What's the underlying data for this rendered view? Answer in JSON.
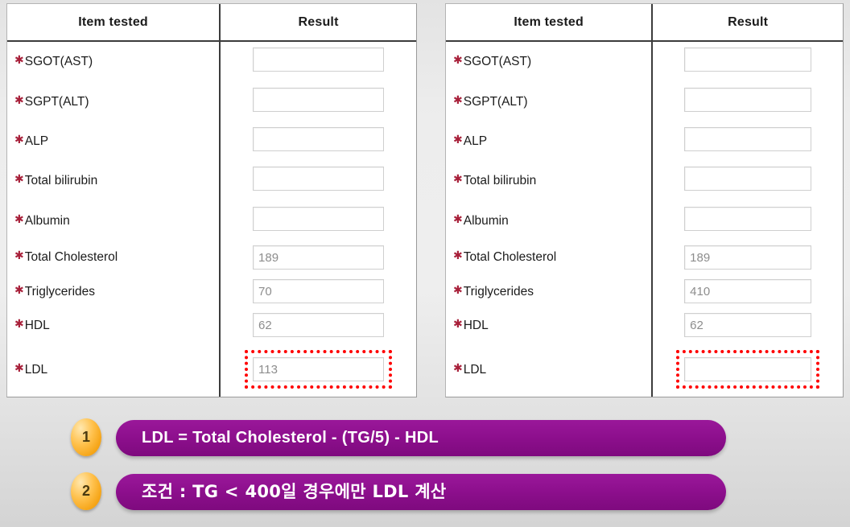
{
  "tables": {
    "columns": [
      "Item tested",
      "Result"
    ],
    "bullet": "✱",
    "left": {
      "rows": [
        {
          "label": "SGOT(AST)",
          "value": "",
          "highlight": false
        },
        {
          "label": "SGPT(ALT)",
          "value": "",
          "highlight": false
        },
        {
          "label": "ALP",
          "value": "",
          "highlight": false
        },
        {
          "label": "Total bilirubin",
          "value": "",
          "highlight": false
        },
        {
          "label": "Albumin",
          "value": "",
          "highlight": false
        },
        {
          "label": "Total Cholesterol",
          "value": "189",
          "highlight": false
        },
        {
          "label": "Triglycerides",
          "value": "70",
          "highlight": false
        },
        {
          "label": "HDL",
          "value": "62",
          "highlight": false
        },
        {
          "label": "LDL",
          "value": "113",
          "highlight": true
        }
      ]
    },
    "right": {
      "rows": [
        {
          "label": "SGOT(AST)",
          "value": "",
          "highlight": false
        },
        {
          "label": "SGPT(ALT)",
          "value": "",
          "highlight": false
        },
        {
          "label": "ALP",
          "value": "",
          "highlight": false
        },
        {
          "label": "Total bilirubin",
          "value": "",
          "highlight": false
        },
        {
          "label": "Albumin",
          "value": "",
          "highlight": false
        },
        {
          "label": "Total Cholesterol",
          "value": "189",
          "highlight": false
        },
        {
          "label": "Triglycerides",
          "value": "410",
          "highlight": false
        },
        {
          "label": "HDL",
          "value": "62",
          "highlight": false
        },
        {
          "label": "LDL",
          "value": "",
          "highlight": true
        }
      ]
    }
  },
  "callouts": [
    {
      "number": "1",
      "text": "LDL = Total Cholesterol - (TG/5) - HDL",
      "korean": false
    },
    {
      "number": "2",
      "text": "조건 : TG < 400일 경우에만 LDL 계산",
      "korean": true
    }
  ],
  "colors": {
    "pill": "#8d0f8d",
    "badge": "#f5a416",
    "highlight": "#ff0000",
    "star": "#a8203a",
    "value_text": "#8d8d8d"
  }
}
